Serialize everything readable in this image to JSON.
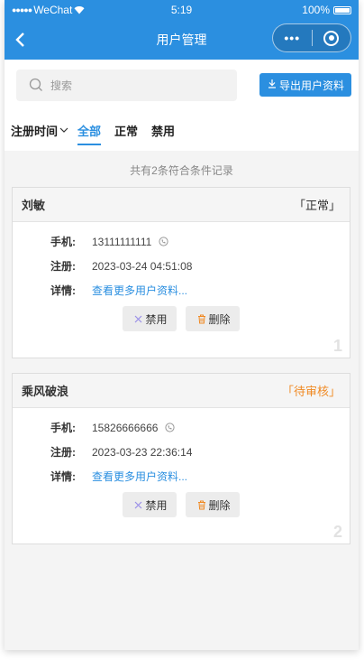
{
  "statusbar": {
    "carrier": "WeChat",
    "time": "5:19",
    "battery": "100%"
  },
  "nav": {
    "title": "用户管理",
    "more": "•••"
  },
  "search": {
    "placeholder": "搜索"
  },
  "export": {
    "label": "导出用户资料"
  },
  "tabs": [
    {
      "label": "注册时间"
    },
    {
      "label": "全部"
    },
    {
      "label": "正常"
    },
    {
      "label": "禁用"
    }
  ],
  "summary": "共有2条符合条件记录",
  "labels": {
    "phone": "手机:",
    "register": "注册:",
    "detail": "详情:",
    "detail_link": "查看更多用户资料...",
    "ban": "禁用",
    "delete": "删除"
  },
  "users": [
    {
      "name": "刘敏",
      "status": "「正常」",
      "phone": "13111111111",
      "registered": "2023-03-24 04:51:08",
      "index": "1"
    },
    {
      "name": "乘风破浪",
      "status": "「待审核」",
      "phone": "15826666666",
      "registered": "2023-03-23 22:36:14",
      "index": "2"
    }
  ],
  "colors": {
    "primary": "#2b8fe0",
    "pending": "#f08a24",
    "delete_icon": "#f08a24",
    "ban_icon": "#9a8fe8"
  }
}
